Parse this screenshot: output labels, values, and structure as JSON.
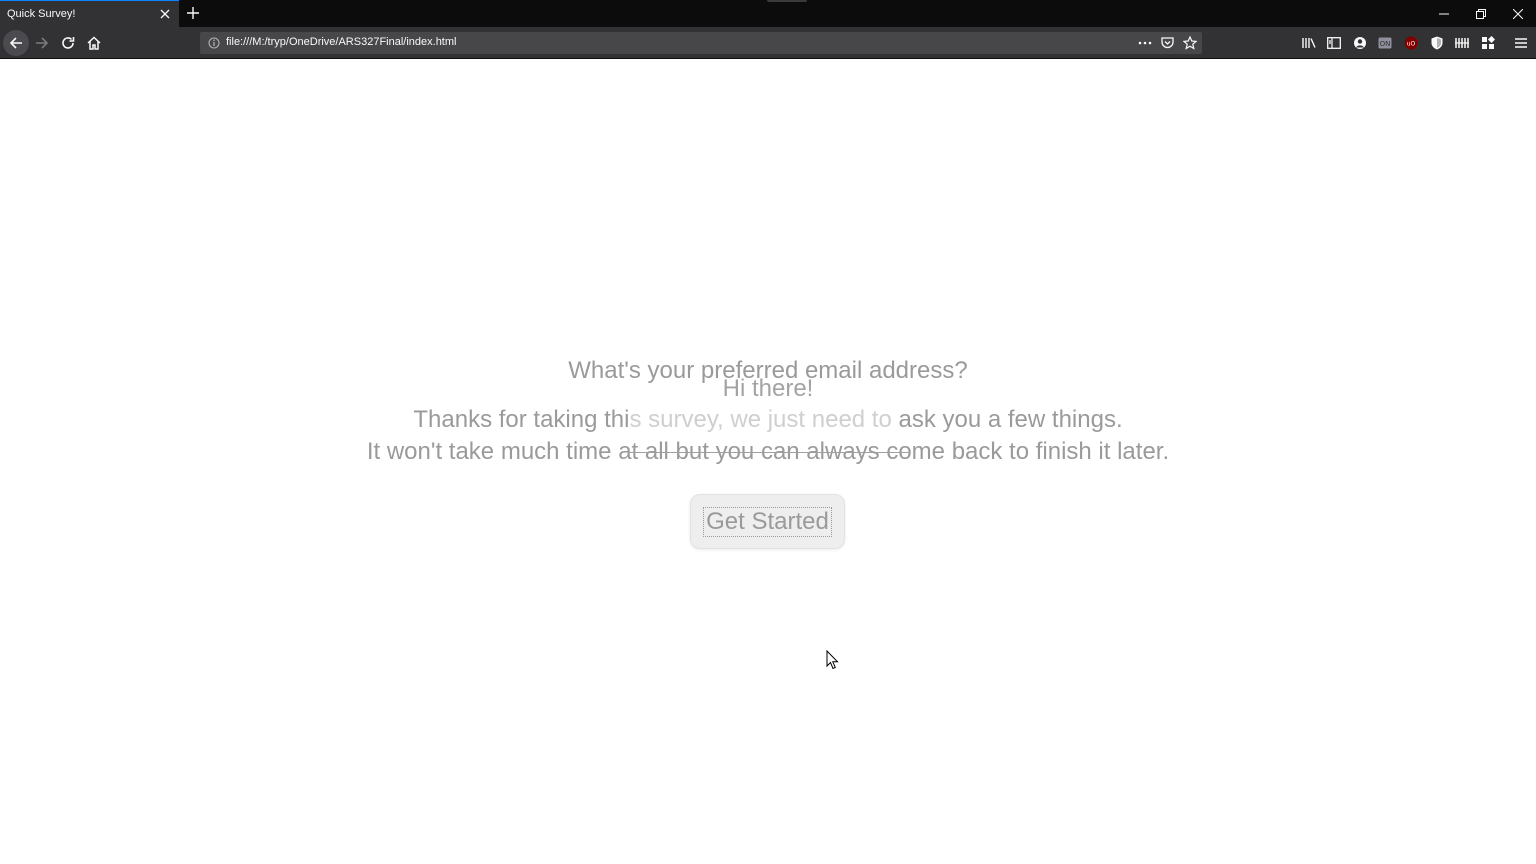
{
  "browser": {
    "tab": {
      "title": "Quick Survey!"
    },
    "url": "file:///M:/tryp/OneDrive/ARS327Final/index.html",
    "nav_icons": [
      "back-arrow-icon",
      "forward-arrow-icon",
      "reload-icon",
      "home-icon"
    ],
    "url_actions": [
      "page-actions-icon",
      "pocket-icon",
      "bookmark-star-icon"
    ],
    "toolbar_icons": [
      "library-icon",
      "sidebar-icon",
      "account-icon",
      "extension-icon",
      "ublock-icon",
      "shield-icon",
      "extension-bars-icon",
      "extension-grid-icon",
      "menu-icon"
    ],
    "window_controls": [
      "minimize-icon",
      "restore-icon",
      "close-icon"
    ]
  },
  "survey": {
    "question": "What's your preferred email address?",
    "greeting": "Hi there!",
    "intro_line1_a": "Thanks for taking thi",
    "intro_line1_b": "s survey, we just need to",
    "intro_line1_c": " ask you a few things.",
    "intro_line2": "It won't take much time at all but you can always come back to finish it later.",
    "start_button_label": "Get Started"
  }
}
